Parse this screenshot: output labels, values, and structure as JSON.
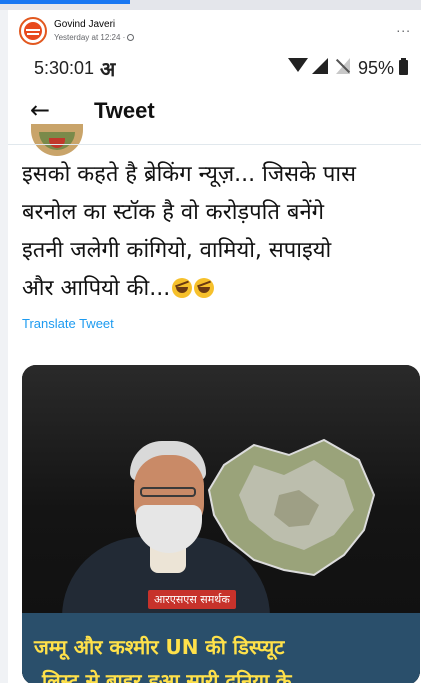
{
  "facebook": {
    "author": "Govind Javeri",
    "timestamp": "Yesterday at 12:24 ·",
    "more_label": "..."
  },
  "statusbar": {
    "time": "5:30:01",
    "carrier_glyph": "अ",
    "battery": "95%"
  },
  "header": {
    "back_glyph": "←",
    "title": "Tweet"
  },
  "tweet": {
    "lines": [
      "इसको कहते है ब्रेकिंग न्यूज़... जिसके पास",
      "बरनोल का स्टॉक है वो करोड़पति बनेंगे",
      "इतनी जलेगी कांगियो, वामियो, सपाइयो",
      "और आपियो की..."
    ],
    "emoji_name": "rolling-on-floor-laughing",
    "translate_label": "Translate Tweet"
  },
  "media": {
    "badge": "आरएसएस समर्थक",
    "banner_line1": "जम्मू और कश्मीर  UN की डिस्प्यूट",
    "banner_line2": "लिस्ट से बाहर हुआ सारी दुनिया के",
    "colors": {
      "banner_bg": "#2a4f6b",
      "banner_text": "#ffe14a",
      "badge_bg": "#c7322b"
    }
  },
  "colors": {
    "link": "#1d9bf0",
    "fb_blue": "#1877f2"
  }
}
